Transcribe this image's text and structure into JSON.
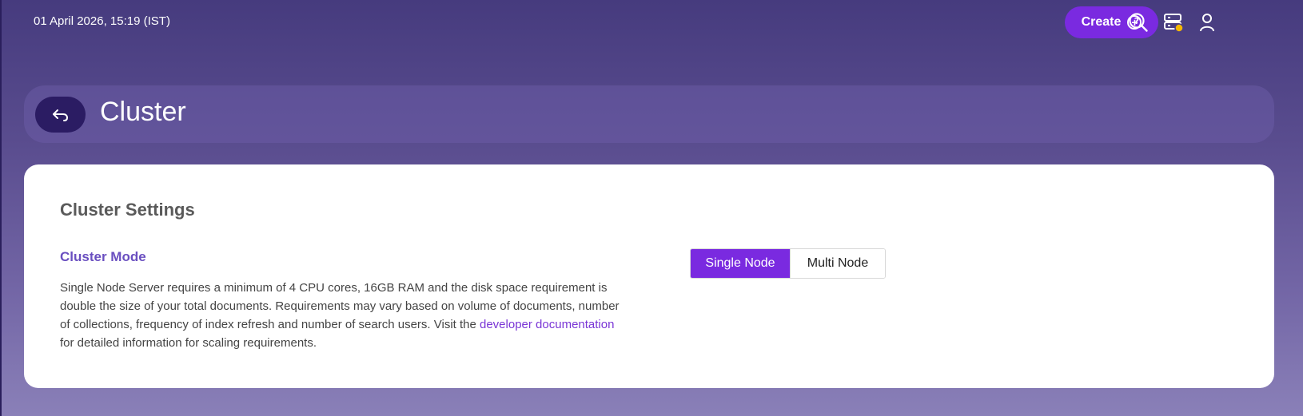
{
  "topbar": {
    "datetime": "01 April 2026, 15:19 (IST)",
    "create_label": "Create",
    "icons": [
      "help-search-icon",
      "server-status-icon",
      "user-icon"
    ],
    "status_dot_color": "#f5b800"
  },
  "header": {
    "title": "Cluster"
  },
  "settings": {
    "section_title": "Cluster Settings",
    "mode_label": "Cluster Mode",
    "description_before_link": "Single Node Server requires a minimum of 4 CPU cores, 16GB RAM and the disk space requirement is double the size of your total documents. Requirements may vary based on volume of documents, number of collections, frequency of index refresh and number of search users. Visit the ",
    "link_text": "developer documentation",
    "description_after_link": " for detailed information for scaling requirements.",
    "mode_options": [
      "Single Node",
      "Multi Node"
    ],
    "selected_mode": "Single Node"
  },
  "colors": {
    "accent": "#7a2ae0",
    "back_button": "#2b1c63",
    "label_purple": "#6a4fc0"
  }
}
